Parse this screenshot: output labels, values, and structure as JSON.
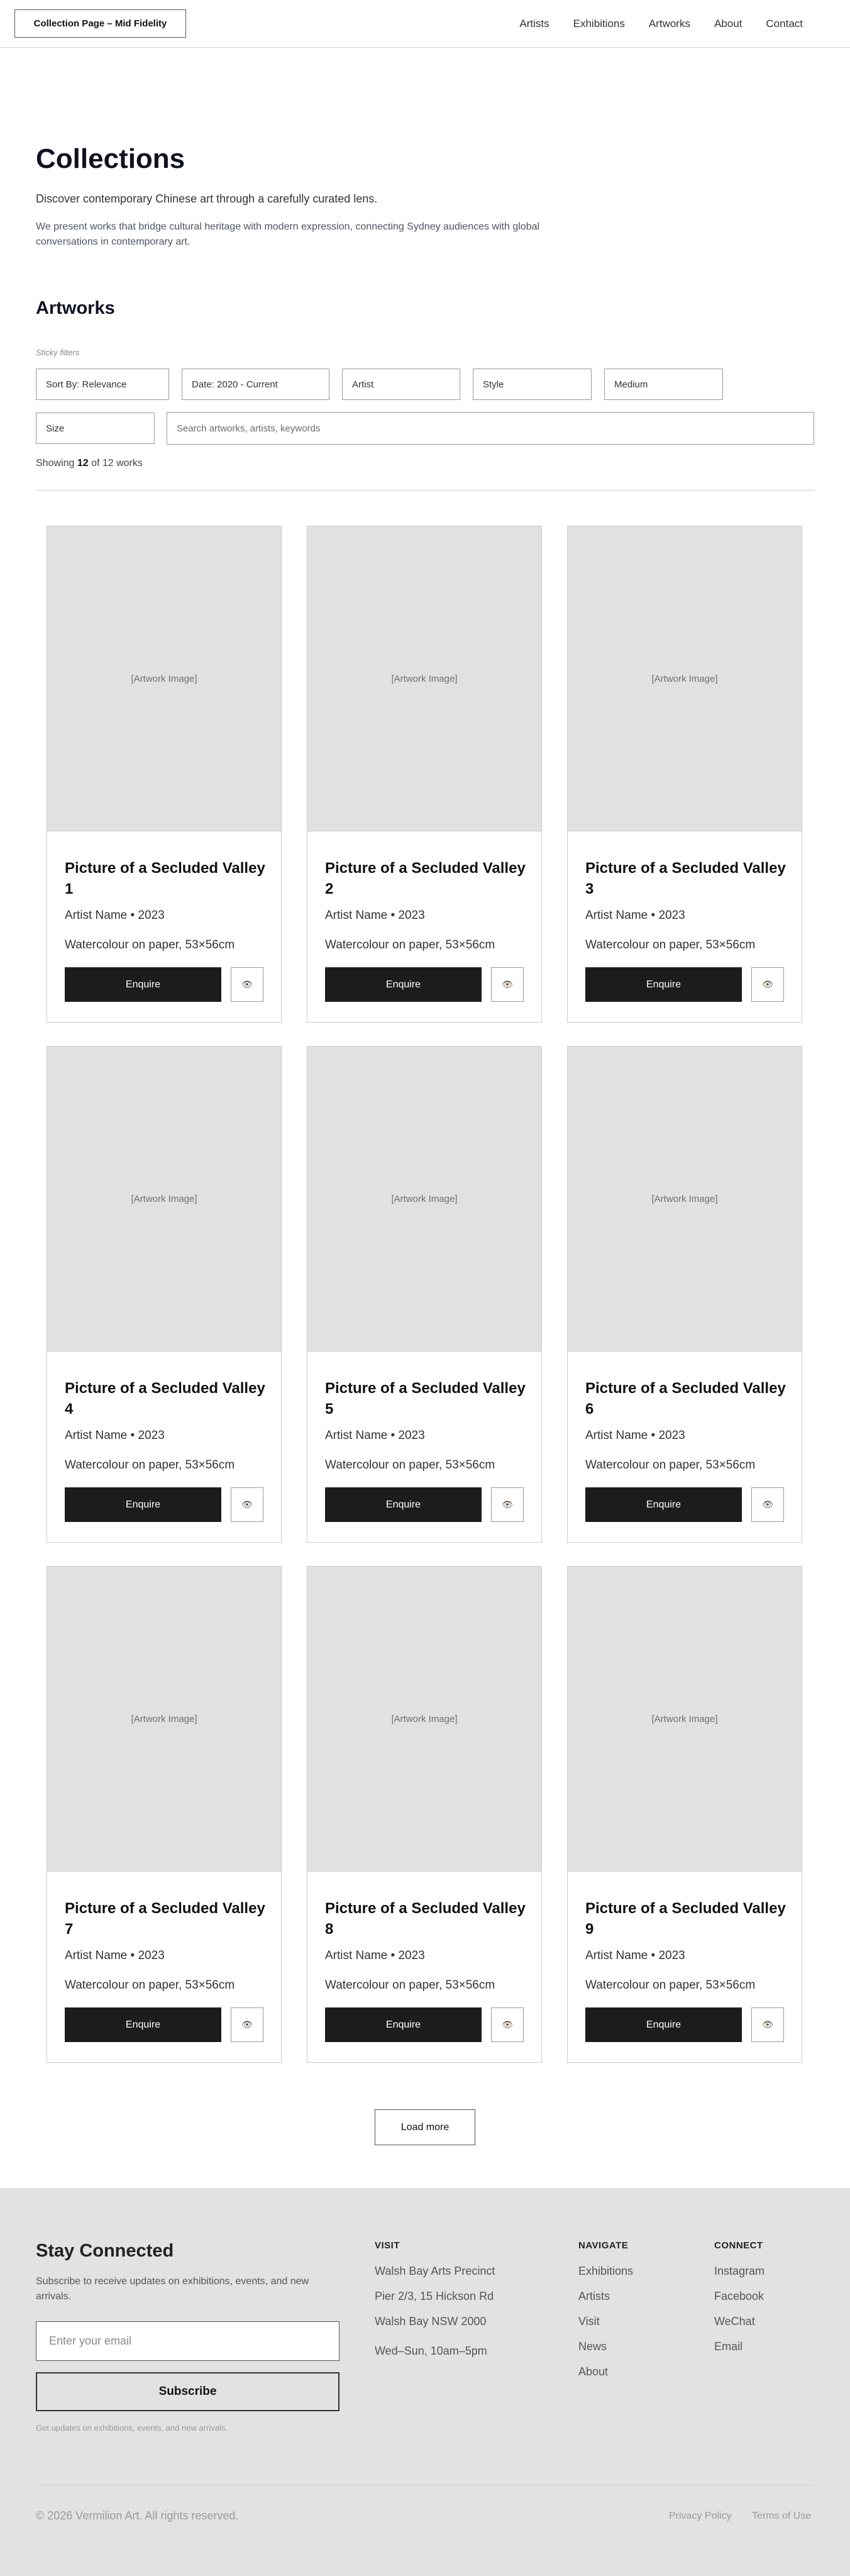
{
  "header": {
    "logo": "Collection Page – Mid Fidelity",
    "nav": [
      "Artists",
      "Exhibitions",
      "Artworks",
      "About",
      "Contact"
    ]
  },
  "hero": {
    "title": "Collections",
    "lead": "Discover contemporary Chinese art through a carefully curated lens.",
    "description": "We present works that bridge cultural heritage with modern expression, connecting Sydney audiences with global conversations in contemporary art."
  },
  "artworks": {
    "title": "Artworks",
    "sticky_label": "Sticky filters",
    "filters": {
      "sort": "Sort By: Relevance",
      "date": "Date: 2020 - Current",
      "artist": "Artist",
      "style": "Style",
      "medium": "Medium",
      "size": "Size"
    },
    "search_placeholder": "Search artworks, artists, keywords",
    "showing_prefix": "Showing",
    "showing_count": "12",
    "showing_suffix": "of 12 works"
  },
  "cards": [
    {
      "image": "[Artwork Image]",
      "title": "Picture of a Secluded Valley 1",
      "artist": "Artist Name • 2023",
      "medium": "Watercolour on paper, 53×56cm",
      "enquire": "Enquire"
    },
    {
      "image": "[Artwork Image]",
      "title": "Picture of a Secluded Valley 2",
      "artist": "Artist Name • 2023",
      "medium": "Watercolour on paper, 53×56cm",
      "enquire": "Enquire"
    },
    {
      "image": "[Artwork Image]",
      "title": "Picture of a Secluded Valley 3",
      "artist": "Artist Name • 2023",
      "medium": "Watercolour on paper, 53×56cm",
      "enquire": "Enquire"
    },
    {
      "image": "[Artwork Image]",
      "title": "Picture of a Secluded Valley 4",
      "artist": "Artist Name • 2023",
      "medium": "Watercolour on paper, 53×56cm",
      "enquire": "Enquire"
    },
    {
      "image": "[Artwork Image]",
      "title": "Picture of a Secluded Valley 5",
      "artist": "Artist Name • 2023",
      "medium": "Watercolour on paper, 53×56cm",
      "enquire": "Enquire"
    },
    {
      "image": "[Artwork Image]",
      "title": "Picture of a Secluded Valley 6",
      "artist": "Artist Name • 2023",
      "medium": "Watercolour on paper, 53×56cm",
      "enquire": "Enquire"
    },
    {
      "image": "[Artwork Image]",
      "title": "Picture of a Secluded Valley 7",
      "artist": "Artist Name • 2023",
      "medium": "Watercolour on paper, 53×56cm",
      "enquire": "Enquire"
    },
    {
      "image": "[Artwork Image]",
      "title": "Picture of a Secluded Valley 8",
      "artist": "Artist Name • 2023",
      "medium": "Watercolour on paper, 53×56cm",
      "enquire": "Enquire"
    },
    {
      "image": "[Artwork Image]",
      "title": "Picture of a Secluded Valley 9",
      "artist": "Artist Name • 2023",
      "medium": "Watercolour on paper, 53×56cm",
      "enquire": "Enquire"
    }
  ],
  "view_icon": "eye-icon",
  "load_more": "Load more",
  "footer": {
    "title": "Stay Connected",
    "subtitle": "Subscribe to receive updates on exhibitions, events, and new arrivals.",
    "email_placeholder": "Enter your email",
    "subscribe": "Subscribe",
    "note": "Get updates on exhibitions, events, and new arrivals.",
    "visit": {
      "title": "VISIT",
      "lines": [
        "Walsh Bay Arts Precinct",
        "Pier 2/3, 15 Hickson Rd",
        "Walsh Bay NSW 2000",
        "Wed–Sun, 10am–5pm"
      ]
    },
    "navigate": {
      "title": "NAVIGATE",
      "links": [
        "Exhibitions",
        "Artists",
        "Visit",
        "News",
        "About"
      ]
    },
    "connect": {
      "title": "CONNECT",
      "links": [
        "Instagram",
        "Facebook",
        "WeChat",
        "Email"
      ]
    },
    "copyright": "© 2026 Vermilion Art. All rights reserved.",
    "privacy": "Privacy Policy",
    "terms": "Terms of Use"
  }
}
